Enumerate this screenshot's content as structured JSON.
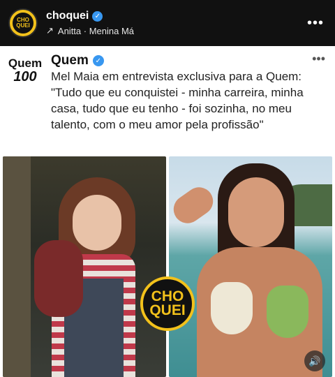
{
  "header": {
    "username": "choquei",
    "music": "Anitta · Menina Má",
    "avatar_text": [
      "CHO",
      "QUEI"
    ],
    "more": "•••"
  },
  "tweet": {
    "logo_top": "Quem",
    "logo_bottom": "100",
    "name": "Quem",
    "more": "•••",
    "text": "Mel Maia em entrevista exclusiva para a Quem: \"Tudo que eu conquistei - minha carreira, minha casa, tudo que eu tenho - foi sozinha, no meu talento, com o meu amor pela profissão\""
  },
  "badge": [
    "CHO",
    "QUEI"
  ],
  "colors": {
    "brand_yellow": "#f2c11b",
    "verified_blue": "#3897f0"
  },
  "icons": {
    "verified": "verified-badge-icon",
    "music": "arrow-icon",
    "sound": "volume-icon"
  }
}
